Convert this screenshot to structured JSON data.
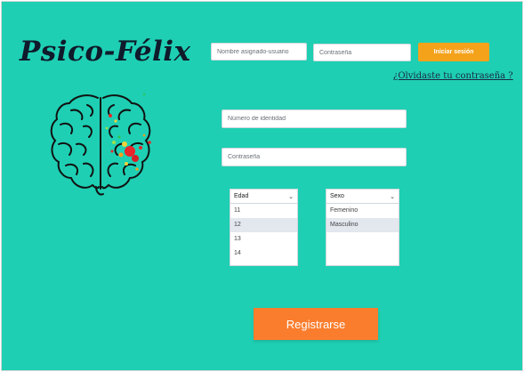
{
  "brand": {
    "logo_text": "Psico-Félix"
  },
  "login": {
    "username_placeholder": "Nombre asignado-usuario",
    "password_placeholder": "Contraseña",
    "login_button": "Iniciar sesión",
    "forgot_link": "¿Olvidaste tu contraseña ?"
  },
  "register": {
    "id_placeholder": "Número de identidad",
    "password_placeholder": "Contraseña",
    "age": {
      "label": "Edad",
      "options": [
        "11",
        "12",
        "13",
        "14"
      ],
      "selected": "12"
    },
    "sex": {
      "label": "Sexo",
      "options": [
        "Femenino",
        "Masculino"
      ],
      "selected": "Masculino"
    },
    "submit_button": "Registrarse"
  },
  "colors": {
    "background": "#1ecfb3",
    "login_button": "#f5a21b",
    "register_button": "#fa7d2d",
    "logo": "#0f1a2a"
  },
  "icons": {
    "brain": "brain-icon",
    "chevron": "chevron-down-icon"
  }
}
